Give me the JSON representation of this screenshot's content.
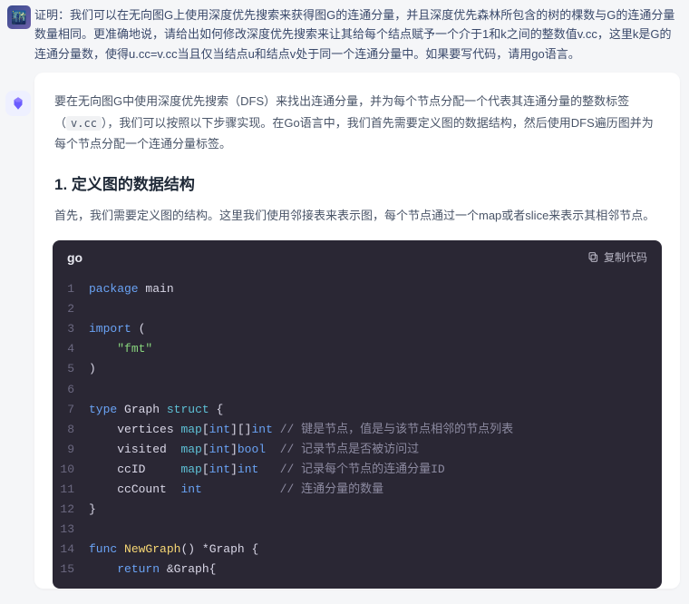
{
  "user": {
    "message": "证明：我们可以在无向图G上使用深度优先搜索来获得图G的连通分量，并且深度优先森林所包含的树的棵数与G的连通分量数量相同。更准确地说，请给出如何修改深度优先搜索来让其给每个结点赋予一个介于1和k之间的整数值v.cc，这里k是G的连通分量数，使得u.cc=v.cc当且仅当结点u和结点v处于同一个连通分量中。如果要写代码，请用go语言。"
  },
  "assistant": {
    "intro_prefix": "要在无向图G中使用深度优先搜索（DFS）来找出连通分量，并为每个节点分配一个代表其连通分量的整数标签（",
    "intro_code": "v.cc",
    "intro_suffix": "），我们可以按照以下步骤实现。在Go语言中，我们首先需要定义图的数据结构，然后使用DFS遍历图并为每个节点分配一个连通分量标签。",
    "heading1": "1. 定义图的数据结构",
    "body1": "首先，我们需要定义图的结构。这里我们使用邻接表来表示图，每个节点通过一个map或者slice来表示其相邻节点。"
  },
  "code": {
    "lang": "go",
    "copy_label": "复制代码",
    "lines": [
      [
        [
          "kw",
          "package"
        ],
        [
          "sp",
          " "
        ],
        [
          "id",
          "main"
        ]
      ],
      [],
      [
        [
          "kw",
          "import"
        ],
        [
          "sp",
          " "
        ],
        [
          "punc",
          "("
        ]
      ],
      [
        [
          "sp",
          "    "
        ],
        [
          "str",
          "\"fmt\""
        ]
      ],
      [
        [
          "punc",
          ")"
        ]
      ],
      [],
      [
        [
          "kw",
          "type"
        ],
        [
          "sp",
          " "
        ],
        [
          "id",
          "Graph"
        ],
        [
          "sp",
          " "
        ],
        [
          "kw2",
          "struct"
        ],
        [
          "sp",
          " "
        ],
        [
          "punc",
          "{"
        ]
      ],
      [
        [
          "sp",
          "    "
        ],
        [
          "id",
          "vertices"
        ],
        [
          "sp",
          " "
        ],
        [
          "kw2",
          "map"
        ],
        [
          "punc",
          "["
        ],
        [
          "type",
          "int"
        ],
        [
          "punc",
          "][]"
        ],
        [
          "type",
          "int"
        ],
        [
          "sp",
          " "
        ],
        [
          "cmt",
          "// 键是节点，值是与该节点相邻的节点列表"
        ]
      ],
      [
        [
          "sp",
          "    "
        ],
        [
          "id",
          "visited"
        ],
        [
          "sp",
          "  "
        ],
        [
          "kw2",
          "map"
        ],
        [
          "punc",
          "["
        ],
        [
          "type",
          "int"
        ],
        [
          "punc",
          "]"
        ],
        [
          "type",
          "bool"
        ],
        [
          "sp",
          "  "
        ],
        [
          "cmt",
          "// 记录节点是否被访问过"
        ]
      ],
      [
        [
          "sp",
          "    "
        ],
        [
          "id",
          "ccID"
        ],
        [
          "sp",
          "     "
        ],
        [
          "kw2",
          "map"
        ],
        [
          "punc",
          "["
        ],
        [
          "type",
          "int"
        ],
        [
          "punc",
          "]"
        ],
        [
          "type",
          "int"
        ],
        [
          "sp",
          "   "
        ],
        [
          "cmt",
          "// 记录每个节点的连通分量ID"
        ]
      ],
      [
        [
          "sp",
          "    "
        ],
        [
          "id",
          "ccCount"
        ],
        [
          "sp",
          "  "
        ],
        [
          "type",
          "int"
        ],
        [
          "sp",
          "           "
        ],
        [
          "cmt",
          "// 连通分量的数量"
        ]
      ],
      [
        [
          "punc",
          "}"
        ]
      ],
      [],
      [
        [
          "kw",
          "func"
        ],
        [
          "sp",
          " "
        ],
        [
          "fn",
          "NewGraph"
        ],
        [
          "punc",
          "()"
        ],
        [
          "sp",
          " "
        ],
        [
          "op",
          "*"
        ],
        [
          "id",
          "Graph"
        ],
        [
          "sp",
          " "
        ],
        [
          "punc",
          "{"
        ]
      ],
      [
        [
          "sp",
          "    "
        ],
        [
          "kw",
          "return"
        ],
        [
          "sp",
          " "
        ],
        [
          "op",
          "&"
        ],
        [
          "id",
          "Graph"
        ],
        [
          "punc",
          "{"
        ]
      ]
    ]
  }
}
